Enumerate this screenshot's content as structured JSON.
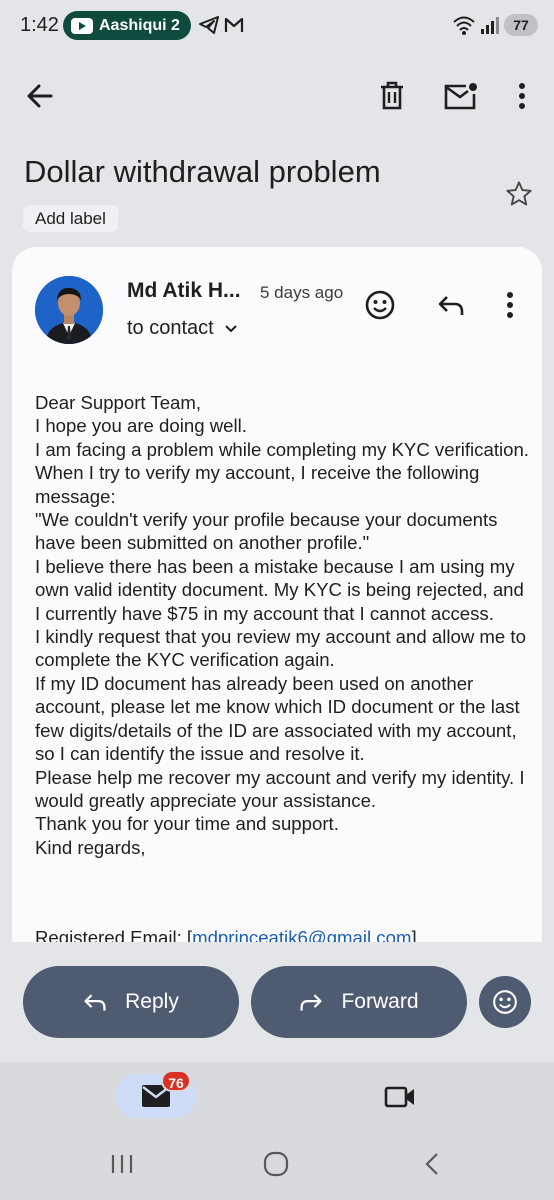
{
  "status_bar": {
    "time": "1:42",
    "notification_app": "Aashiqui 2",
    "battery": "77",
    "icons": [
      "youtube-icon",
      "telegram-icon",
      "gmail-icon",
      "wifi-icon",
      "signal-icon"
    ]
  },
  "toolbar": {
    "icons": [
      "back-arrow-icon",
      "delete-icon",
      "mark-unread-icon",
      "more-vert-icon"
    ]
  },
  "email": {
    "subject": "Dollar withdrawal problem",
    "add_label": "Add label",
    "sender": "Md Atik H...",
    "time_ago": "5 days ago",
    "to_line": "to contact",
    "body": "Dear Support Team,\nI hope you are doing well.\nI am facing a problem while completing my KYC verification. When I try to verify my account, I receive the following message:\n\"We couldn't verify your profile because your documents have been submitted on another profile.\"\nI believe there has been a mistake because I am using my own valid identity document. My KYC is being rejected, and I currently have $75 in my account that I cannot access.\nI kindly request that you review my account and allow me to complete the KYC verification again.\nIf my ID document has already been used on another account, please let me know which ID document or the last few digits/details of the ID are associated with my account, so I can identify the issue and resolve it.\nPlease help me recover my account and verify my identity. I would greatly appreciate your assistance.\nThank you for your time and support.\nKind regards,",
    "registered_email_label": "Registered Email: [",
    "registered_email_link": "mdprinceatik6@gmail.com",
    "registered_email_suffix": "]"
  },
  "actions": {
    "reply": "Reply",
    "forward": "Forward"
  },
  "bottom_nav": {
    "mail_badge": "76"
  },
  "colors": {
    "background": "#e4e5e9",
    "card": "#fbfbfd",
    "action_button": "#4f5b70",
    "badge": "#d93025",
    "link": "#1a5fb4"
  }
}
